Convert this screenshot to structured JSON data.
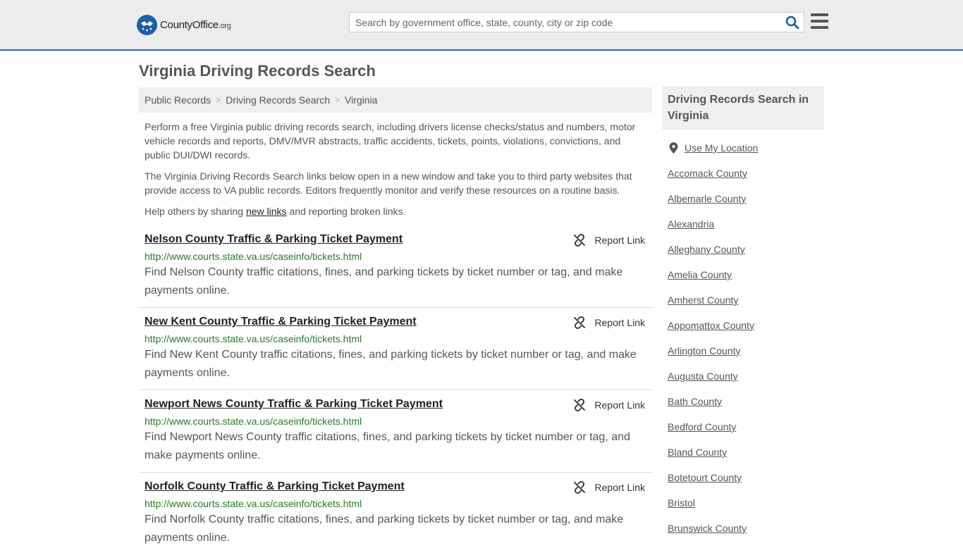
{
  "header": {
    "logo_brand": "CountyOffice",
    "logo_tld": ".org",
    "search_placeholder": "Search by government office, state, county, city or zip code"
  },
  "page_title": "Virginia Driving Records Search",
  "breadcrumb": [
    "Public Records",
    "Driving Records Search",
    "Virginia"
  ],
  "intro": {
    "p1": "Perform a free Virginia public driving records search, including drivers license checks/status and numbers, motor vehicle records and reports, DMV/MVR abstracts, traffic accidents, tickets, points, violations, convictions, and public DUI/DWI records.",
    "p2": "The Virginia Driving Records Search links below open in a new window and take you to third party websites that provide access to VA public records. Editors frequently monitor and verify these resources on a routine basis.",
    "p3_before": "Help others by sharing ",
    "p3_link": "new links",
    "p3_after": " and reporting broken links."
  },
  "report_label": "Report Link",
  "results": [
    {
      "title": "Nelson County Traffic & Parking Ticket Payment",
      "url": "http://www.courts.state.va.us/caseinfo/tickets.html",
      "desc": "Find Nelson County traffic citations, fines, and parking tickets by ticket number or tag, and make payments online."
    },
    {
      "title": "New Kent County Traffic & Parking Ticket Payment",
      "url": "http://www.courts.state.va.us/caseinfo/tickets.html",
      "desc": "Find New Kent County traffic citations, fines, and parking tickets by ticket number or tag, and make payments online."
    },
    {
      "title": "Newport News County Traffic & Parking Ticket Payment",
      "url": "http://www.courts.state.va.us/caseinfo/tickets.html",
      "desc": "Find Newport News County traffic citations, fines, and parking tickets by ticket number or tag, and make payments online."
    },
    {
      "title": "Norfolk County Traffic & Parking Ticket Payment",
      "url": "http://www.courts.state.va.us/caseinfo/tickets.html",
      "desc": "Find Norfolk County traffic citations, fines, and parking tickets by ticket number or tag, and make payments online."
    }
  ],
  "sidebar": {
    "heading": "Driving Records Search in Virginia",
    "location_label": "Use My Location",
    "counties": [
      "Accomack County",
      "Albemarle County",
      "Alexandria",
      "Alleghany County",
      "Amelia County",
      "Amherst County",
      "Appomattox County",
      "Arlington County",
      "Augusta County",
      "Bath County",
      "Bedford County",
      "Bland County",
      "Botetourt County",
      "Bristol",
      "Brunswick County"
    ]
  },
  "colors": {
    "accent": "#2a6fb8",
    "url_green": "#287a28",
    "header_bg": "#ececec"
  },
  "icons": {
    "search": "search-icon",
    "menu": "hamburger-menu-icon",
    "report": "broken-link-icon",
    "location": "map-pin-icon"
  }
}
